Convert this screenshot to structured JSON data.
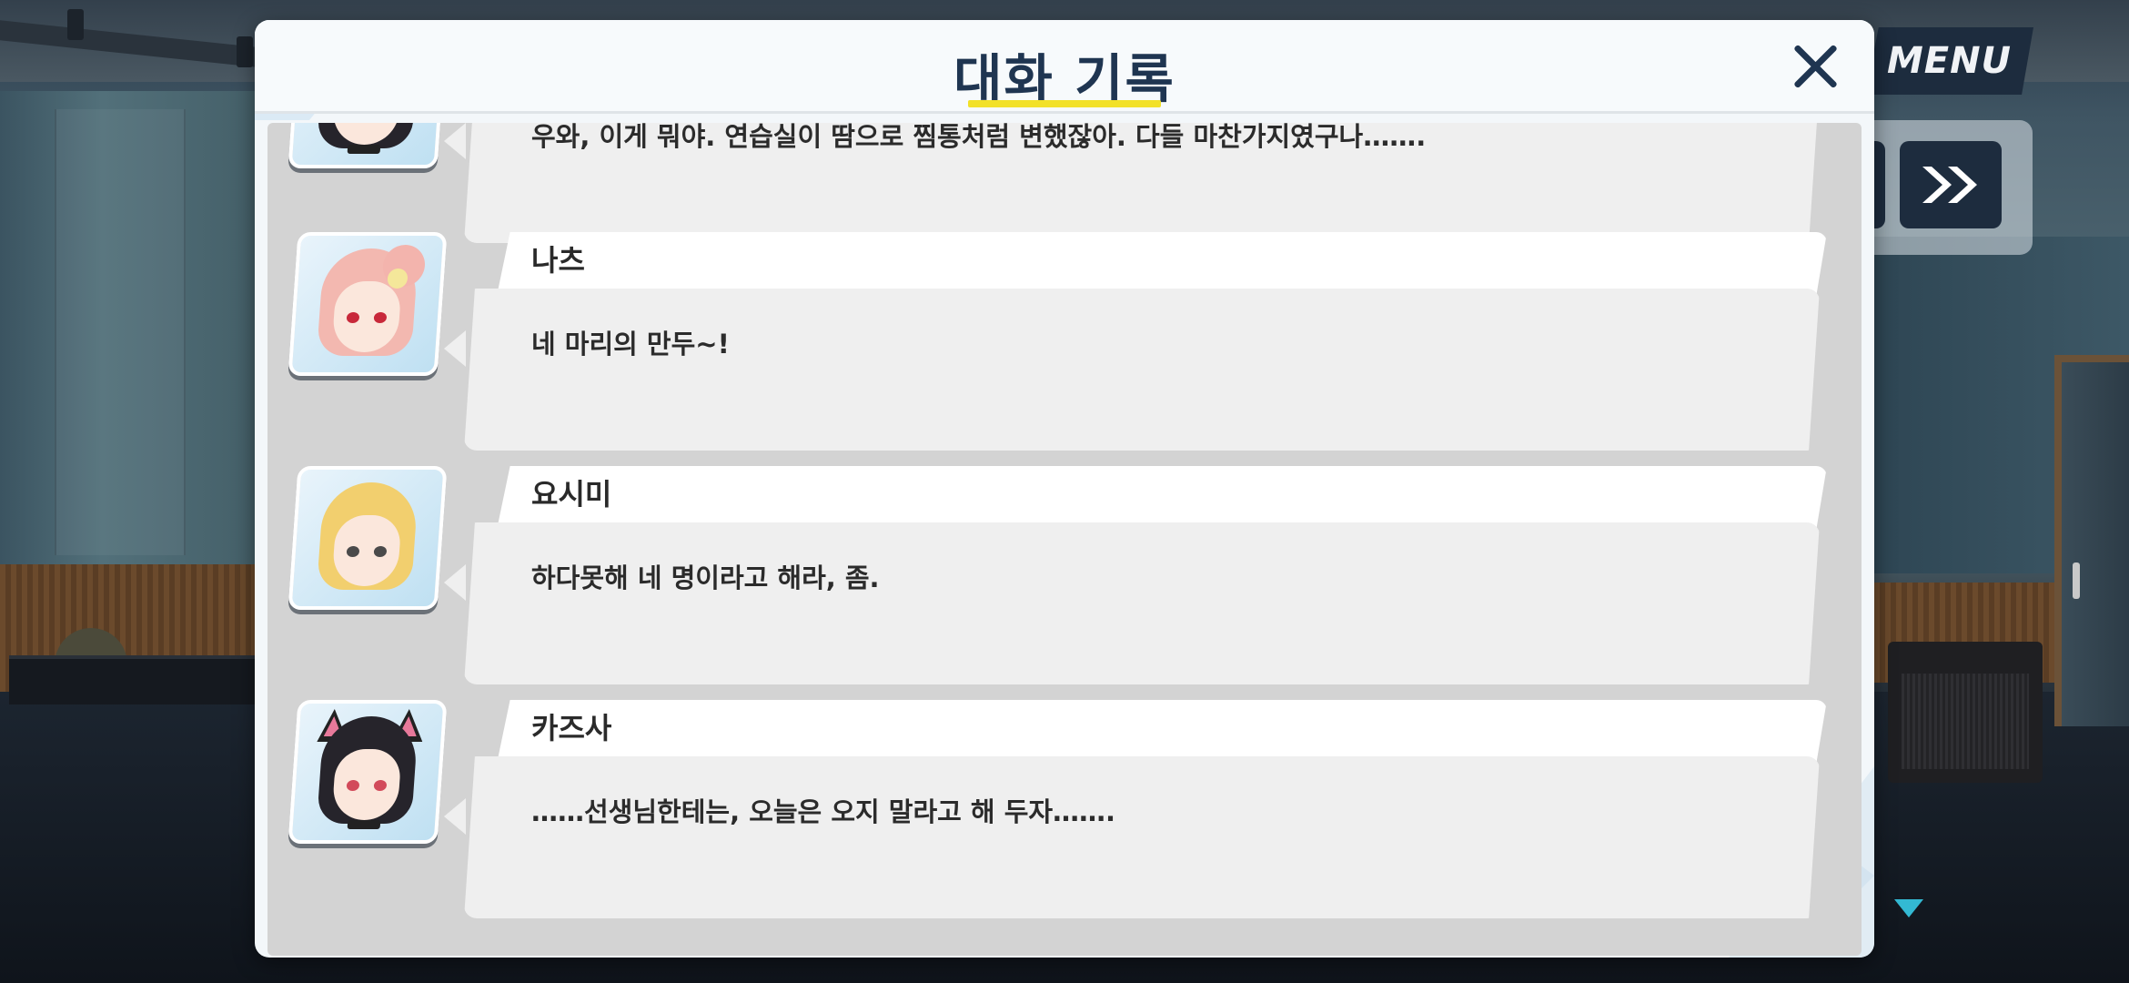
{
  "hud": {
    "menu_label": "MENU",
    "skip_icon": "fast-forward-icon",
    "scroll_indicator_icon": "triangle-down-icon"
  },
  "dialog": {
    "title": "대화 기록",
    "close_icon": "close-icon",
    "accent_color": "#f2e128",
    "title_color": "#1f3551"
  },
  "log": {
    "entries": [
      {
        "name": "",
        "message": "우와, 이게 뭐야. 연습실이 땀으로 찜통처럼 변했잖아. 다들 마찬가지였구나……."
      },
      {
        "name": "나츠",
        "message": "네 마리의 만두~!"
      },
      {
        "name": "요시미",
        "message": "하다못해 네 명이라고 해라, 좀."
      },
      {
        "name": "카즈사",
        "message": "……선생님한테는, 오늘은 오지 말라고 해 두자……."
      }
    ]
  }
}
